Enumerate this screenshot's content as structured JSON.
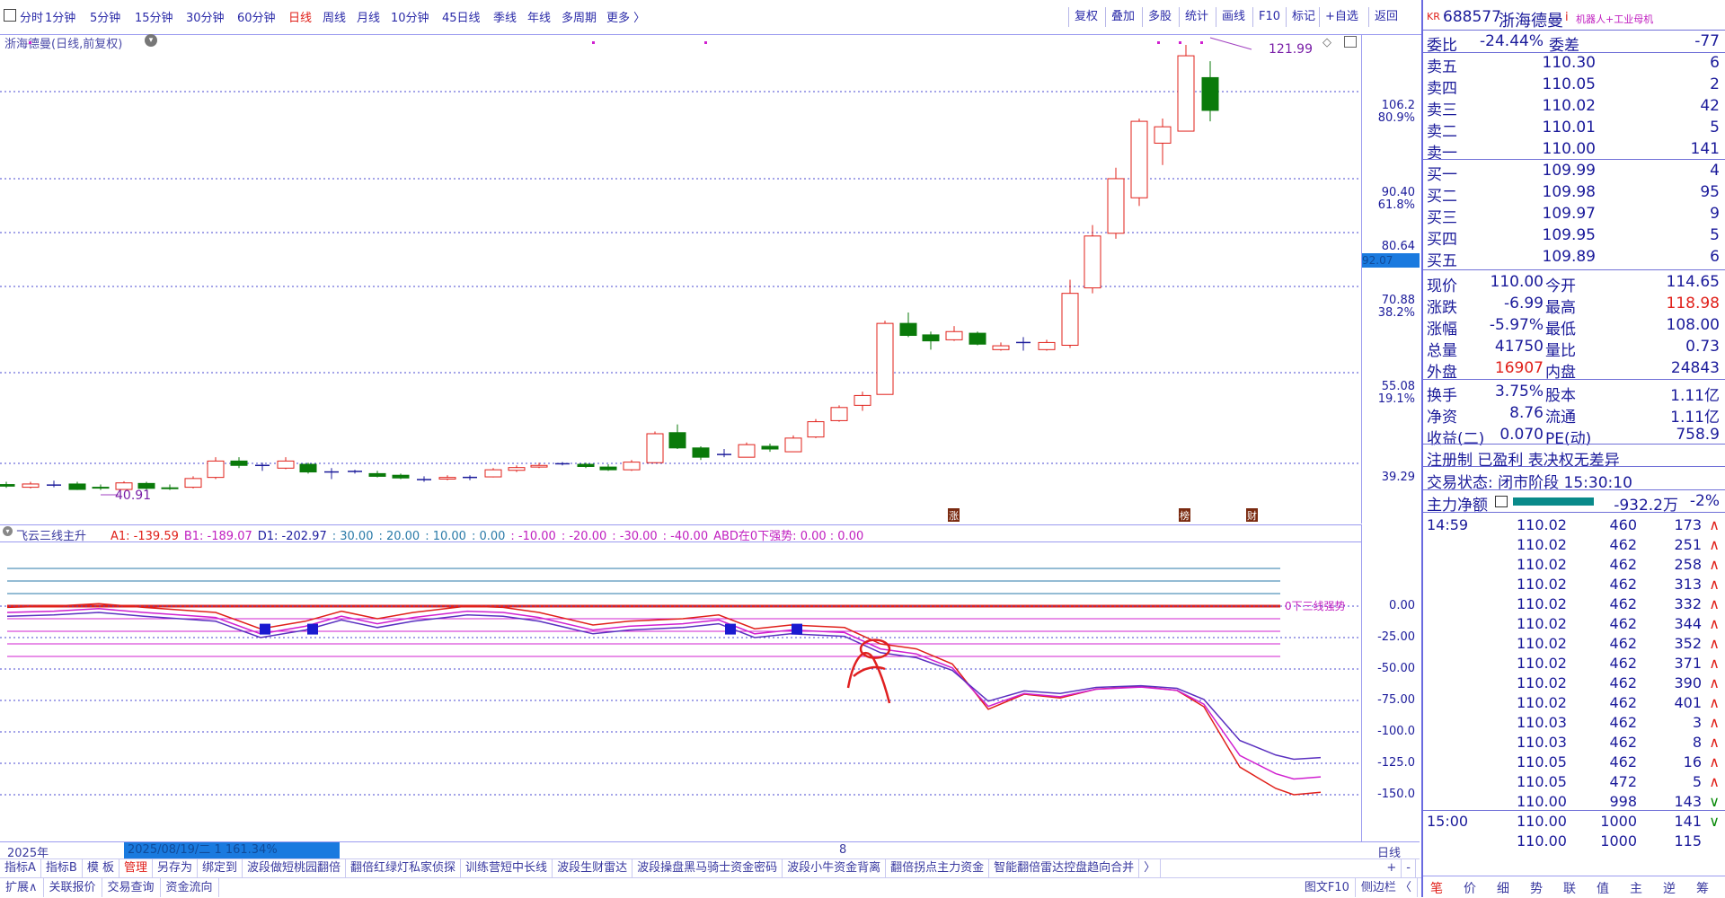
{
  "toolbar": {
    "periods": [
      "分时",
      "1分钟",
      "5分钟",
      "15分钟",
      "30分钟",
      "60分钟",
      "日线",
      "周线",
      "月线",
      "10分钟",
      "45日线",
      "季线",
      "年线",
      "多周期",
      "更多 〉"
    ],
    "active_period": "日线",
    "right_buttons": [
      "复权",
      "叠加",
      "多股",
      "统计",
      "画线",
      "F10",
      "标记",
      "+自选",
      "返回"
    ]
  },
  "chart": {
    "title": "浙海德曼(日线,前复权)",
    "high_label": "121.99",
    "low_label": "40.91",
    "price_labels": [
      {
        "v": "106.2",
        "pct": "80.9%"
      },
      {
        "v": "90.40",
        "pct": "61.8%"
      },
      {
        "v": "80.64",
        "pct": ""
      },
      {
        "v": "70.88",
        "pct": "38.2%"
      },
      {
        "v": "55.08",
        "pct": "19.1%"
      },
      {
        "v": "39.29",
        "pct": ""
      }
    ],
    "current_price_tag": "92.07",
    "event_labels": [
      "涨",
      "榜",
      "财"
    ]
  },
  "indicator": {
    "name": "飞云三线主升",
    "values": [
      {
        "t": "A1: -139.59",
        "c": "#e0201a"
      },
      {
        "t": "B1: -189.07",
        "c": "#c020c0"
      },
      {
        "t": "D1: -202.97",
        "c": "#2020a0"
      },
      {
        "t": ": 30.00",
        "c": "#2a7aa8"
      },
      {
        "t": ": 20.00",
        "c": "#2a7aa8"
      },
      {
        "t": ": 10.00",
        "c": "#2a7aa8"
      },
      {
        "t": ": 0.00",
        "c": "#2a7aa8"
      },
      {
        "t": ": -10.00",
        "c": "#c020c0"
      },
      {
        "t": ": -20.00",
        "c": "#c020c0"
      },
      {
        "t": ": -30.00",
        "c": "#c020c0"
      },
      {
        "t": ": -40.00",
        "c": "#c020c0"
      },
      {
        "t": "ABD在0下强势: 0.00 : 0.00",
        "c": "#c020c0"
      }
    ],
    "zero_label": "0下三线强势",
    "axis": [
      "0.00",
      "-25.00",
      "-50.00",
      "-75.00",
      "-100.0",
      "-125.0",
      "-150.0"
    ]
  },
  "datebar": {
    "year": "2025年",
    "selected": "2025/08/19/二 1 161.34%",
    "mark": "8",
    "period": "日线"
  },
  "tabs1": [
    "指标A",
    "指标B",
    "模 板",
    "管理",
    "另存为",
    "绑定到",
    "波段做短桃园翻倍",
    "翻倍红绿灯私家侦探",
    "训练营短中长线",
    "波段生财雷达",
    "波段操盘黑马骑士资金密码",
    "波段小牛资金背离",
    "翻倍拐点主力资金",
    "智能翻倍雷达控盘趋向合并",
    "〉"
  ],
  "tabs1_right": [
    "+",
    "-"
  ],
  "tabs2": [
    "扩展∧",
    "关联报价",
    "交易查询",
    "资金流向"
  ],
  "tabs2_right": [
    "图文F10",
    "侧边栏 〈"
  ],
  "panel": {
    "code": "688577",
    "name": "浙海德曼",
    "market": "KR",
    "tag": "机器人+工业母机",
    "weibi": {
      "label": "委比",
      "v": "-24.44%",
      "label2": "委差",
      "v2": "-77"
    },
    "asks": [
      {
        "l": "卖五",
        "p": "110.30",
        "q": "6"
      },
      {
        "l": "卖四",
        "p": "110.05",
        "q": "2"
      },
      {
        "l": "卖三",
        "p": "110.02",
        "q": "42"
      },
      {
        "l": "卖二",
        "p": "110.01",
        "q": "5"
      },
      {
        "l": "卖一",
        "p": "110.00",
        "q": "141"
      }
    ],
    "bids": [
      {
        "l": "买一",
        "p": "109.99",
        "q": "4"
      },
      {
        "l": "买二",
        "p": "109.98",
        "q": "95"
      },
      {
        "l": "买三",
        "p": "109.97",
        "q": "9"
      },
      {
        "l": "买四",
        "p": "109.95",
        "q": "5"
      },
      {
        "l": "买五",
        "p": "109.89",
        "q": "6"
      }
    ],
    "stats": [
      {
        "l": "现价",
        "v": "110.00",
        "vc": "blue",
        "l2": "今开",
        "v2": "114.65",
        "v2c": "blue"
      },
      {
        "l": "涨跌",
        "v": "-6.99",
        "vc": "blue",
        "l2": "最高",
        "v2": "118.98",
        "v2c": "red"
      },
      {
        "l": "涨幅",
        "v": "-5.97%",
        "vc": "blue",
        "l2": "最低",
        "v2": "108.00",
        "v2c": "blue"
      },
      {
        "l": "总量",
        "v": "41750",
        "vc": "blue",
        "l2": "量比",
        "v2": "0.73",
        "v2c": "blue"
      },
      {
        "l": "外盘",
        "v": "16907",
        "vc": "red",
        "l2": "内盘",
        "v2": "24843",
        "v2c": "blue"
      }
    ],
    "stats2": [
      {
        "l": "换手",
        "v": "3.75%",
        "vc": "blue",
        "l2": "股本",
        "v2": "1.11亿",
        "v2c": "blue"
      },
      {
        "l": "净资",
        "v": "8.76",
        "vc": "blue",
        "l2": "流通",
        "v2": "1.11亿",
        "v2c": "blue"
      },
      {
        "l": "收益(二)",
        "v": "0.070",
        "vc": "blue",
        "l2": "PE(动)",
        "v2": "758.9",
        "v2c": "blue"
      }
    ],
    "reg": "注册制 已盈利 表决权无差异",
    "status": "交易状态: 闭市阶段 15:30:10",
    "mainflow": {
      "label": "主力净额",
      "v": "-932.2万",
      "pct": "-2%"
    },
    "ticks": [
      {
        "t": "14:59",
        "p": "110.02",
        "n": "460",
        "c": "173",
        "d": "∧"
      },
      {
        "t": "",
        "p": "110.02",
        "n": "462",
        "c": "251",
        "d": "∧"
      },
      {
        "t": "",
        "p": "110.02",
        "n": "462",
        "c": "258",
        "d": "∧"
      },
      {
        "t": "",
        "p": "110.02",
        "n": "462",
        "c": "313",
        "d": "∧"
      },
      {
        "t": "",
        "p": "110.02",
        "n": "462",
        "c": "332",
        "d": "∧"
      },
      {
        "t": "",
        "p": "110.02",
        "n": "462",
        "c": "344",
        "d": "∧"
      },
      {
        "t": "",
        "p": "110.02",
        "n": "462",
        "c": "352",
        "d": "∧"
      },
      {
        "t": "",
        "p": "110.02",
        "n": "462",
        "c": "371",
        "d": "∧"
      },
      {
        "t": "",
        "p": "110.02",
        "n": "462",
        "c": "390",
        "d": "∧"
      },
      {
        "t": "",
        "p": "110.02",
        "n": "462",
        "c": "401",
        "d": "∧"
      },
      {
        "t": "",
        "p": "110.03",
        "n": "462",
        "c": "3",
        "d": "∧"
      },
      {
        "t": "",
        "p": "110.03",
        "n": "462",
        "c": "8",
        "d": "∧"
      },
      {
        "t": "",
        "p": "110.05",
        "n": "462",
        "c": "16",
        "d": "∧"
      },
      {
        "t": "",
        "p": "110.05",
        "n": "472",
        "c": "5",
        "d": "∧"
      },
      {
        "t": "",
        "p": "110.00",
        "n": "998",
        "c": "143",
        "d": "∨"
      },
      {
        "t": "15:00",
        "p": "110.00",
        "n": "1000",
        "c": "141",
        "d": "∨"
      },
      {
        "t": "",
        "p": "110.00",
        "n": "1000",
        "c": "115",
        "d": ""
      }
    ],
    "bottom_tabs": [
      "笔",
      "价",
      "细",
      "势",
      "联",
      "值",
      "主",
      "逆",
      "筹"
    ]
  }
}
